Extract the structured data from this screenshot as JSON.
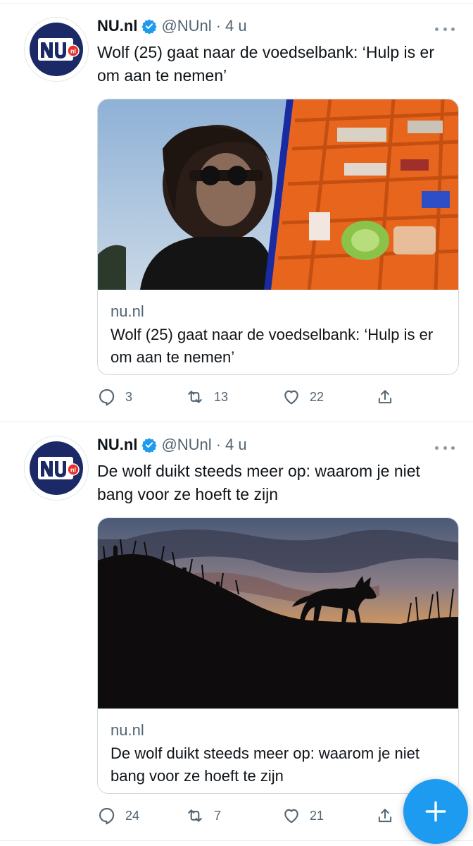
{
  "tweets": [
    {
      "name": "NU.nl",
      "handle": "@NUnl",
      "separator": "·",
      "time": "4 u",
      "avatar_badge": "nl",
      "text": "Wolf (25) gaat naar de voedselbank: ‘Hulp is er om aan te nemen’",
      "card": {
        "domain": "nu.nl",
        "title": "Wolf (25) gaat naar de voedselbank: ‘Hulp is er om aan te nemen’",
        "image": "person-and-food-crates-photo"
      },
      "actions": {
        "replies": "3",
        "retweets": "13",
        "likes": "22"
      }
    },
    {
      "name": "NU.nl",
      "handle": "@NUnl",
      "separator": "·",
      "time": "4 u",
      "avatar_badge": "nl",
      "text": "De wolf duikt steeds meer op: waarom je niet bang voor ze hoeft te zijn",
      "card": {
        "domain": "nu.nl",
        "title": "De wolf duikt steeds meer op: waarom je niet bang voor ze hoeft te zijn",
        "image": "wolf-silhouette-sunset-photo"
      },
      "actions": {
        "replies": "24",
        "retweets": "7",
        "likes": "21"
      }
    }
  ],
  "fab": {
    "icon": "plus-icon",
    "color": "#1d9bf0"
  },
  "colors": {
    "brand_navy": "#1b2a66",
    "badge_red": "#e4312b",
    "verified_blue": "#1d9bf0",
    "muted": "#536471"
  }
}
